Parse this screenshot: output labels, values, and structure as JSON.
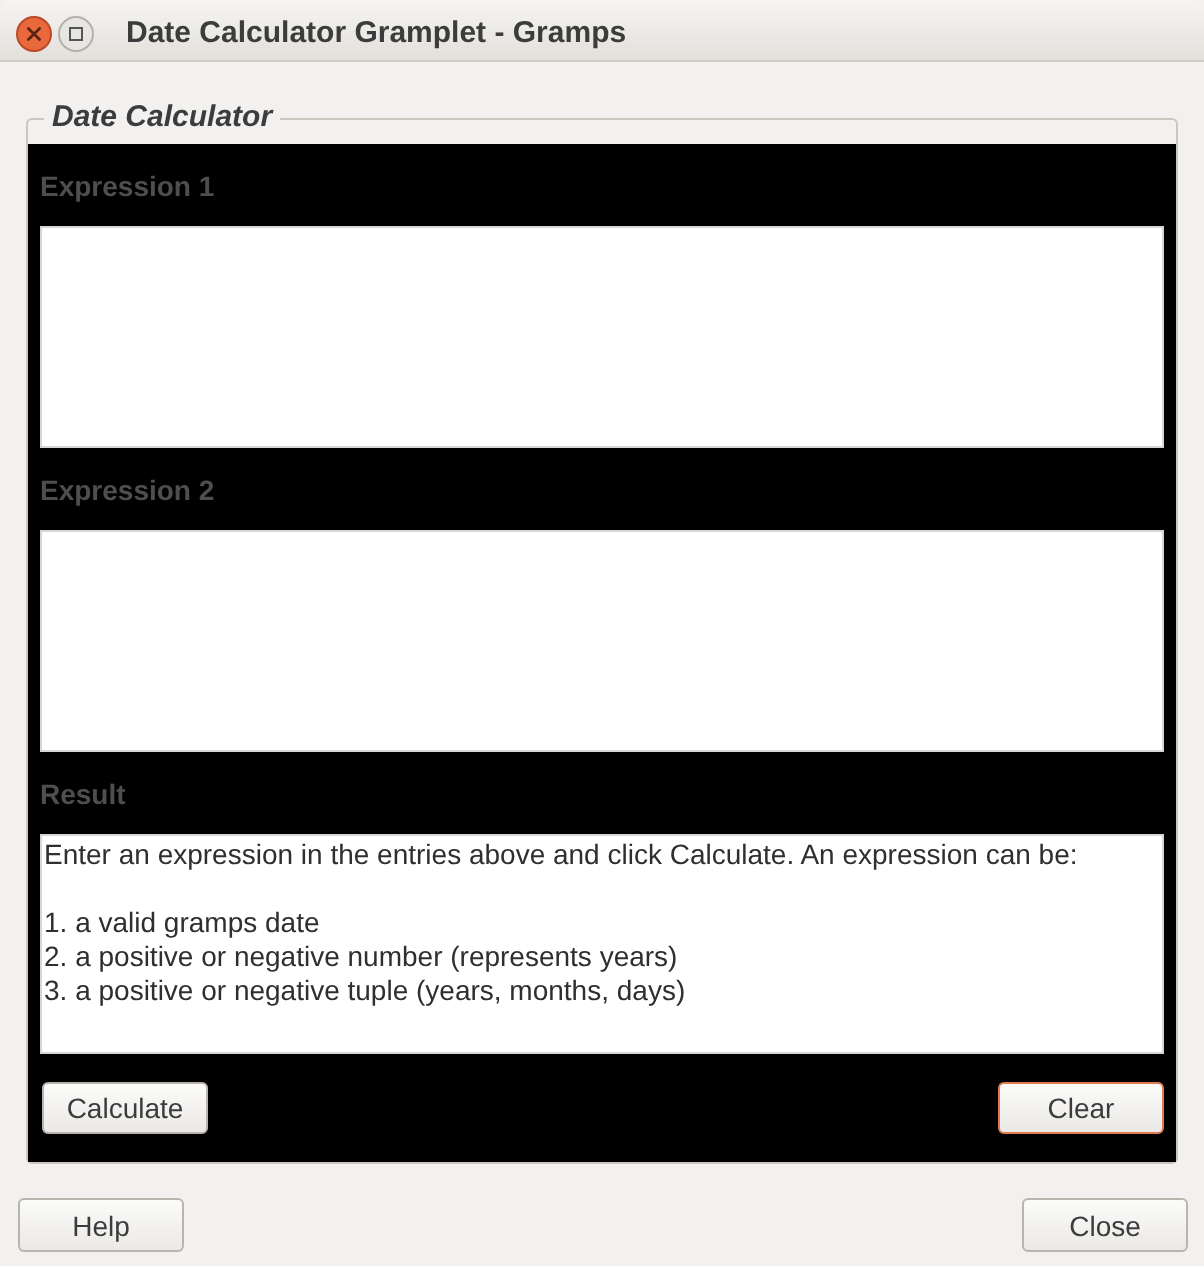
{
  "window": {
    "title": "Date Calculator Gramplet - Gramps"
  },
  "frame": {
    "label": "Date Calculator"
  },
  "expressions": [
    {
      "label": "Expression 1"
    },
    {
      "label": "Expression 2"
    }
  ],
  "result": {
    "label": "Result",
    "intro": "Enter an expression in the entries above and click Calculate. An expression can be:",
    "items": [
      "1. a valid gramps date",
      "2. a positive or negative number (represents years)",
      "3. a positive or negative tuple (years, months, days)"
    ]
  },
  "actions": [
    {
      "label": "Calculate",
      "focused": false
    },
    {
      "label": "Clear",
      "focused": true
    }
  ],
  "buttons": [
    {
      "label": "Help"
    },
    {
      "label": "Close"
    }
  ]
}
